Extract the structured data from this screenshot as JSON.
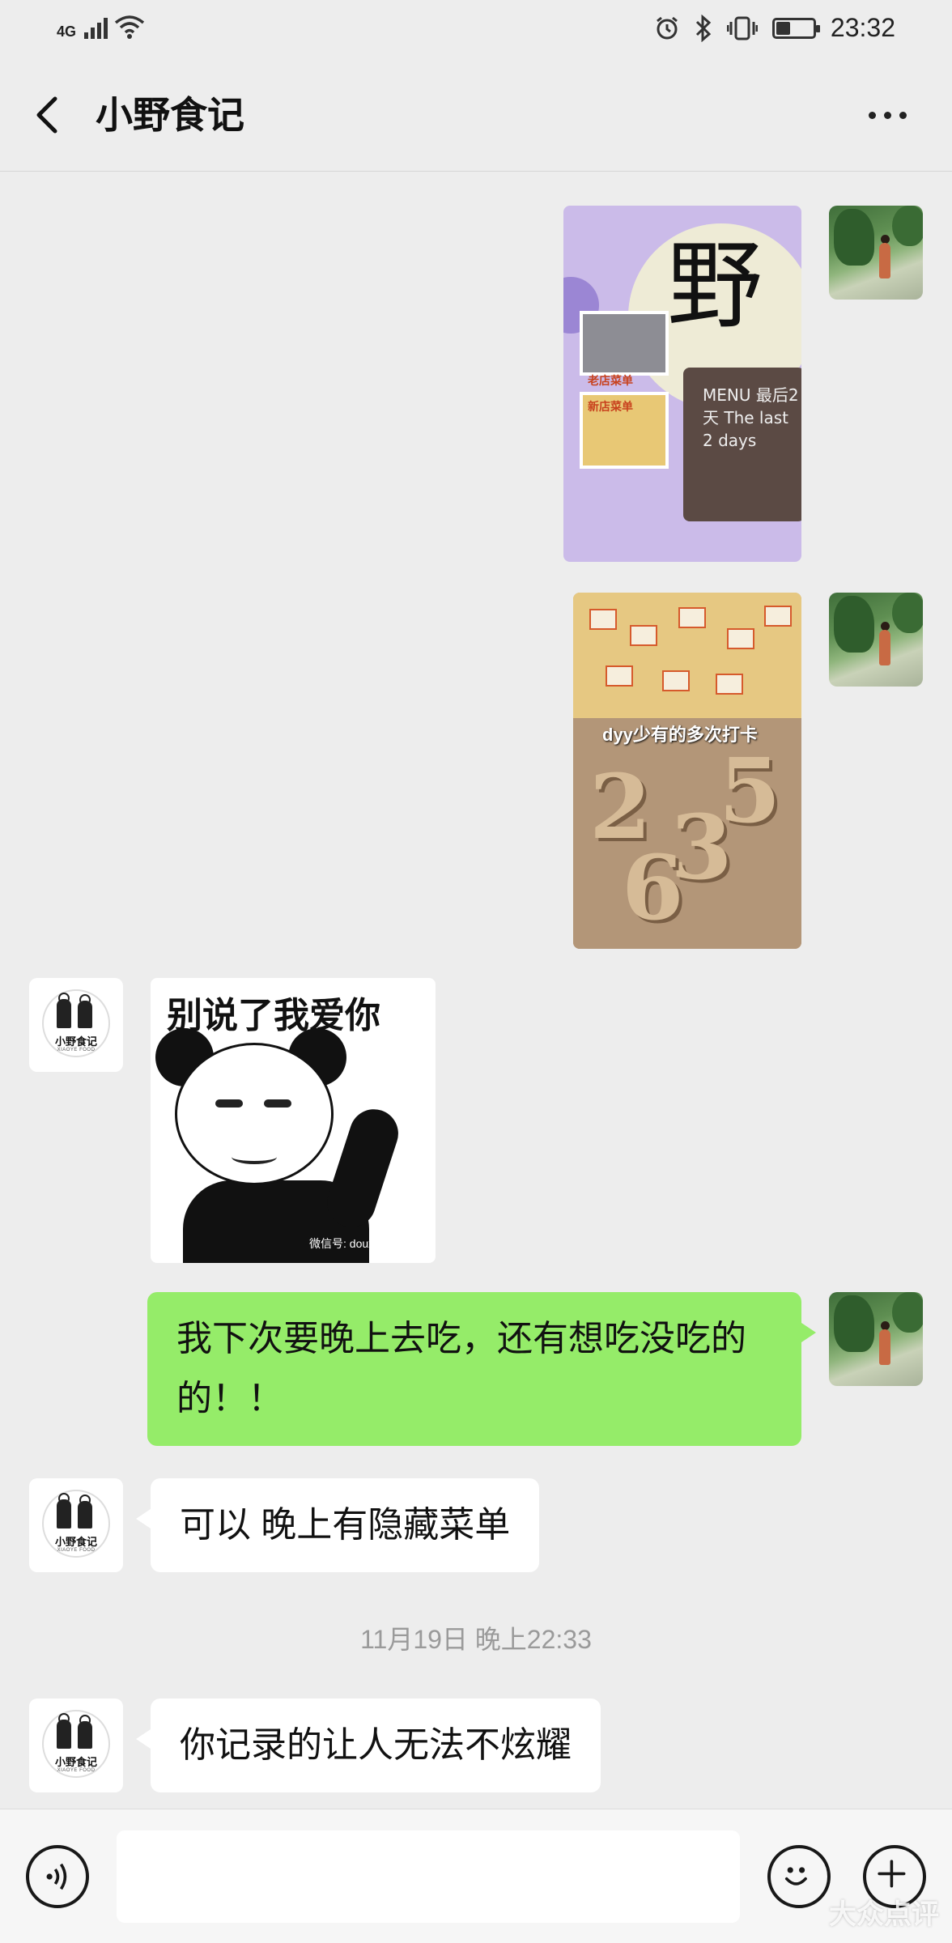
{
  "status_bar": {
    "network": "4G",
    "time": "23:32",
    "battery_level": 0.35,
    "icons": [
      "signal-icon",
      "wifi-icon",
      "alarm-icon",
      "bluetooth-icon",
      "vibrate-icon",
      "battery-icon"
    ]
  },
  "header": {
    "title": "小野食记",
    "back_icon": "chevron-left-icon",
    "more_icon": "more-dots-icon"
  },
  "messages": [
    {
      "type": "image",
      "side": "outgoing",
      "image": {
        "glyph": "野",
        "board_text": "MENU 最后2天 The last 2 days",
        "label_top": "老店菜单",
        "label_bottom": "新店菜单"
      }
    },
    {
      "type": "image",
      "side": "outgoing",
      "image": {
        "caption": "dyy少有的多次打卡"
      }
    },
    {
      "type": "sticker",
      "side": "incoming",
      "image": {
        "caption": "别说了我爱你",
        "watermark": "微信号: douxiaoku"
      }
    },
    {
      "type": "text",
      "side": "outgoing",
      "text": "我下次要晚上去吃，还有想吃没吃的的！！"
    },
    {
      "type": "text",
      "side": "incoming",
      "text": "可以 晚上有隐藏菜单"
    },
    {
      "type": "timestamp",
      "text": "11月19日 晚上22:33"
    },
    {
      "type": "text",
      "side": "incoming",
      "text": "你记录的让人无法不炫耀"
    }
  ],
  "avatar_logo": {
    "name": "小野食记",
    "sub": "XIAOYE FOOD"
  },
  "input_bar": {
    "placeholder": "",
    "voice_icon": "voice-icon",
    "emoji_icon": "emoji-icon",
    "plus_icon": "plus-icon"
  },
  "watermark": "大众点评"
}
